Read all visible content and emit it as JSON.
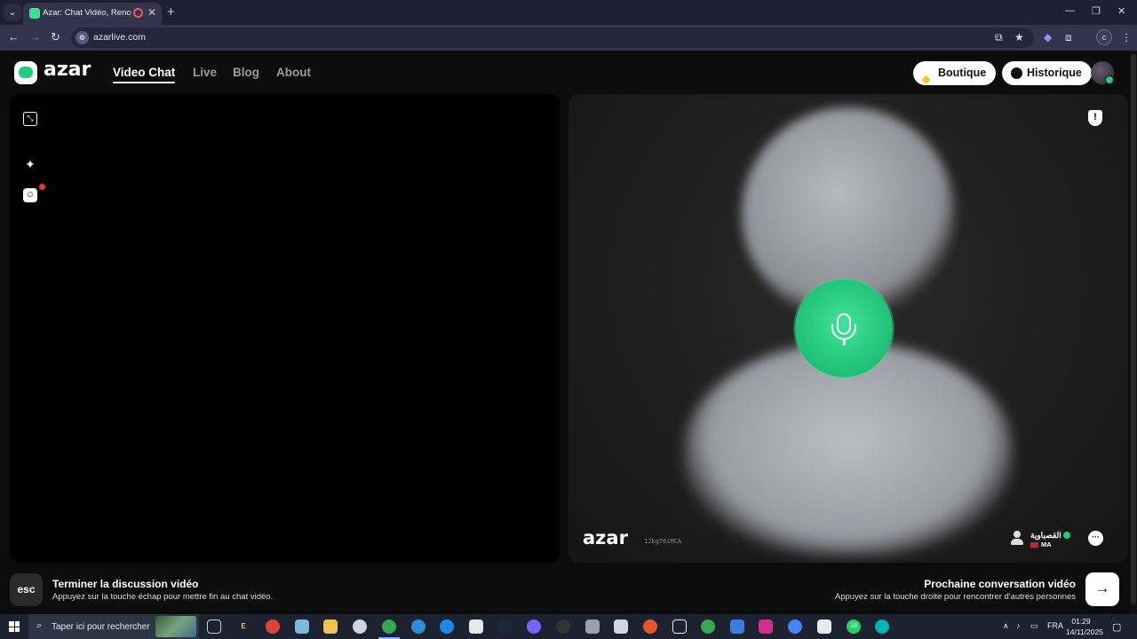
{
  "browser": {
    "tab_title": "Azar: Chat Vidéo, Rencontr",
    "url": "azarlive.com",
    "profile_initial": "c"
  },
  "header": {
    "logo_text": "azar",
    "nav": {
      "video_chat": "Video Chat",
      "live": "Live",
      "blog": "Blog",
      "about": "About"
    },
    "boutique_label": "Boutique",
    "historique_label": "Historique"
  },
  "remote": {
    "watermark": "azar",
    "session_id": "1JkgT6iMCA",
    "peer_name": "القصباوية",
    "peer_country": "MA"
  },
  "footer": {
    "esc_key": "esc",
    "end_title": "Terminer la discussion vidéo",
    "end_hint": "Appuyez sur la touche échap pour mettre fin au chat vidéo.",
    "next_title": "Prochaine conversation vidéo",
    "next_hint": "Appuyez sur la touche droite pour rencontrer d'autres personnes"
  },
  "taskbar": {
    "search_placeholder": "Taper ici pour rechercher",
    "language": "FRA",
    "time": "01:29",
    "date": "14/11/2025",
    "whatsapp_badge": "18"
  },
  "colors": {
    "accent_green": "#1fcf78",
    "browser_chrome": "#35344f",
    "page_background": "#0c0c0c"
  }
}
